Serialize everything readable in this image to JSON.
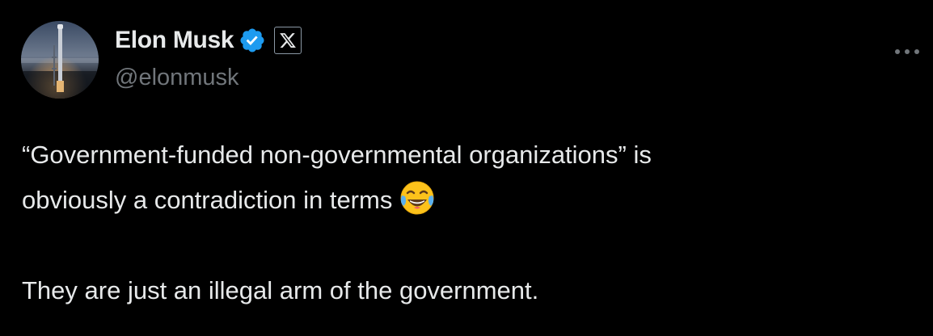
{
  "author": {
    "display_name": "Elon Musk",
    "handle": "@elonmusk",
    "avatar_icon": "rocket-launch-avatar",
    "verified_icon": "verified-badge-icon",
    "verified_color": "#1d9bf0",
    "affiliation_icon": "x-logo-icon"
  },
  "menu": {
    "icon": "more-options-icon"
  },
  "tweet": {
    "lines": [
      "“Government-funded non-governmental organizations” is",
      "obviously a contradiction in terms",
      "They are just an illegal arm of the government."
    ],
    "emoji": "face-with-tears-of-joy"
  },
  "colors": {
    "background": "#000000",
    "text_primary": "#e7e9ea",
    "text_secondary": "#71767b"
  }
}
